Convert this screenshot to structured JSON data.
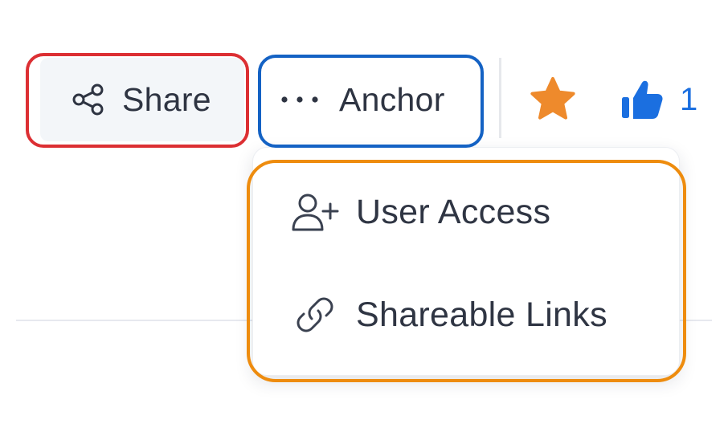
{
  "toolbar": {
    "share": {
      "label": "Share",
      "icon": "share-icon"
    },
    "anchor": {
      "label": "Anchor",
      "icon": "more-horizontal-icon"
    },
    "favorite": {
      "icon": "star-icon",
      "color": "#ee8a2c"
    },
    "like": {
      "icon": "thumbs-up-icon",
      "count": "1",
      "color": "#1b6fe0"
    }
  },
  "dropdown": {
    "items": [
      {
        "label": "User Access",
        "icon": "user-plus-icon"
      },
      {
        "label": "Shareable Links",
        "icon": "link-icon"
      }
    ]
  },
  "annotations": {
    "colors": {
      "share": "#dc2f33",
      "anchor": "#1462c4",
      "dropdown": "#ee8c0e"
    }
  }
}
